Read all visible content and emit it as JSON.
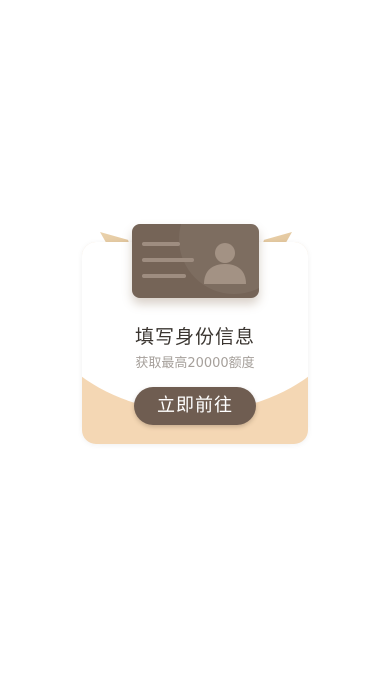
{
  "card": {
    "title": "填写身份信息",
    "subtitle": "获取最高20000额度",
    "button_label": "立即前往"
  },
  "icons": {
    "id_card": "id-card-icon",
    "avatar": "person-icon"
  },
  "colors": {
    "card_brown": "#756457",
    "button_brown": "#6f5d51",
    "panel_peach": "#f4d7b4",
    "ribbon_gold": "#dcbb8c",
    "title_text": "#3a3530",
    "subtitle_text": "#a6a09b"
  }
}
